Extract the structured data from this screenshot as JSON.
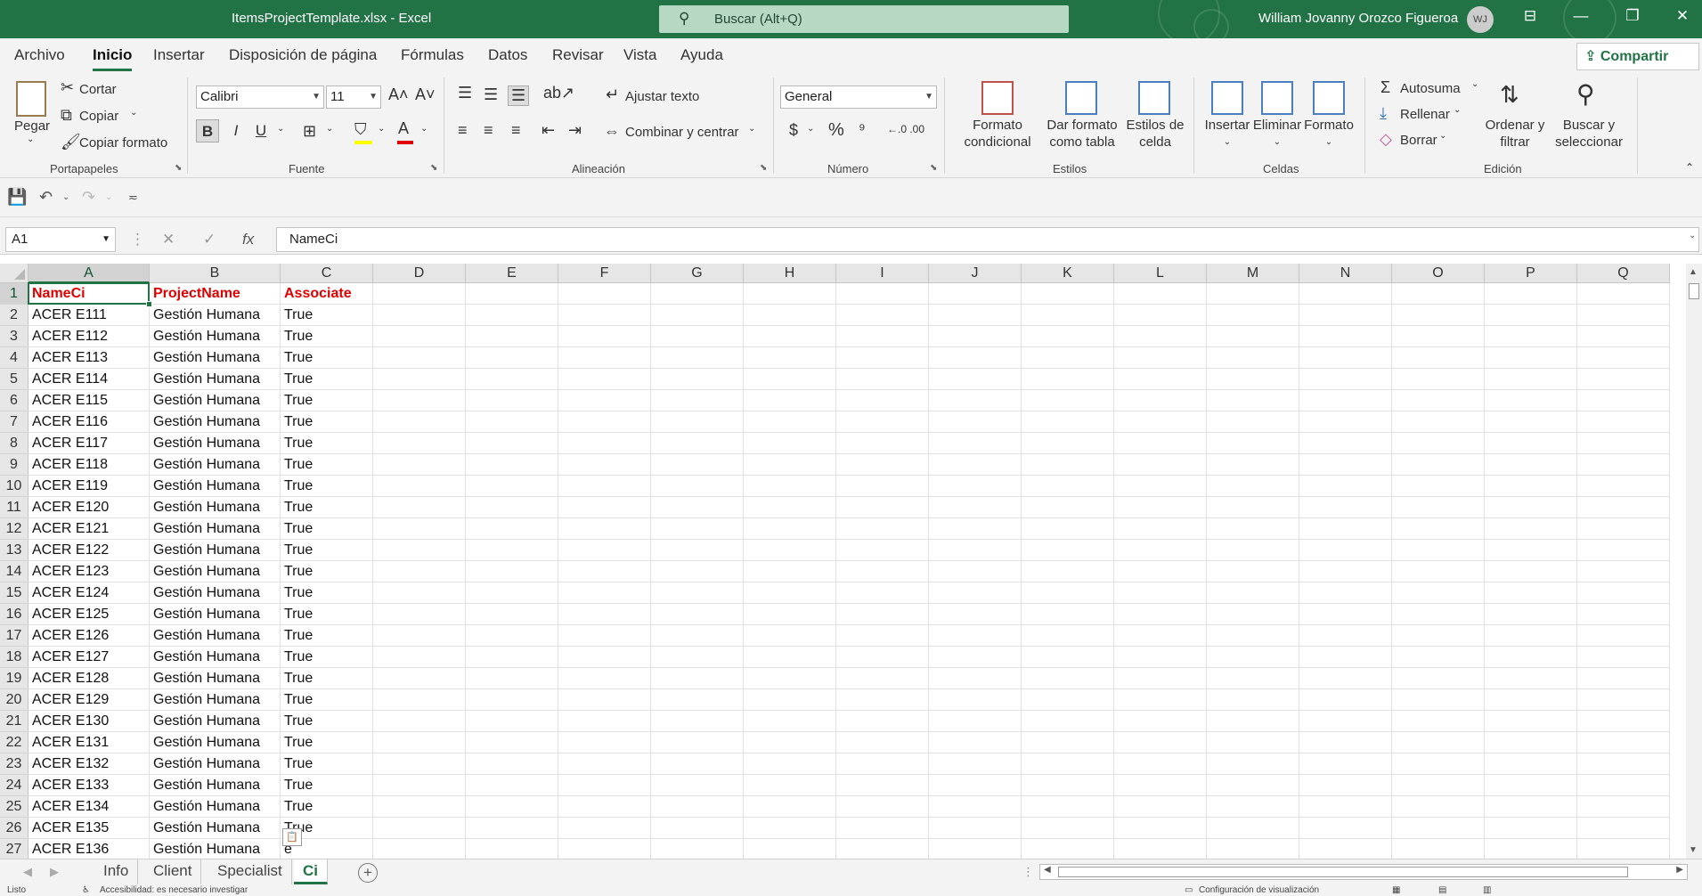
{
  "titlebar": {
    "doc_title": "ItemsProjectTemplate.xlsx  -  Excel",
    "search_placeholder": "Buscar (Alt+Q)",
    "user_name": "William Jovanny Orozco Figueroa",
    "avatar_initials": "WJ"
  },
  "menu": {
    "tabs": [
      "Archivo",
      "Inicio",
      "Insertar",
      "Disposición de página",
      "Fórmulas",
      "Datos",
      "Revisar",
      "Vista",
      "Ayuda"
    ],
    "active_tab": "Inicio",
    "share_label": "Compartir"
  },
  "ribbon": {
    "portapapeles": {
      "group_label": "Portapapeles",
      "paste": "Pegar",
      "cut": "Cortar",
      "copy": "Copiar",
      "format_painter": "Copiar formato"
    },
    "fuente": {
      "group_label": "Fuente",
      "font_name": "Calibri",
      "font_size": "11",
      "bold": "B",
      "italic": "I",
      "underline": "U"
    },
    "alineacion": {
      "group_label": "Alineación",
      "wrap_text": "Ajustar texto",
      "merge_center": "Combinar y centrar"
    },
    "numero": {
      "group_label": "Número",
      "format": "General"
    },
    "estilos": {
      "group_label": "Estilos",
      "conditional_l1": "Formato",
      "conditional_l2": "condicional",
      "table_l1": "Dar formato",
      "table_l2": "como tabla",
      "cell_styles_l1": "Estilos de",
      "cell_styles_l2": "celda"
    },
    "celdas": {
      "group_label": "Celdas",
      "insert": "Insertar",
      "delete": "Eliminar",
      "format": "Formato"
    },
    "edicion": {
      "group_label": "Edición",
      "autosum": "Autosuma",
      "fill": "Rellenar",
      "clear": "Borrar",
      "sort_l1": "Ordenar y",
      "sort_l2": "filtrar",
      "find_l1": "Buscar y",
      "find_l2": "seleccionar"
    }
  },
  "formula_bar": {
    "name_box": "A1",
    "formula": "NameCi"
  },
  "sheet": {
    "columns": [
      "A",
      "B",
      "C",
      "D",
      "E",
      "F",
      "G",
      "H",
      "I",
      "J",
      "K",
      "L",
      "M",
      "N",
      "O",
      "P",
      "Q"
    ],
    "rows": [
      [
        "1",
        "NameCi",
        "ProjectName",
        "Associate"
      ],
      [
        "2",
        "ACER E111",
        "Gestión Humana",
        "True"
      ],
      [
        "3",
        "ACER E112",
        "Gestión Humana",
        "True"
      ],
      [
        "4",
        "ACER E113",
        "Gestión Humana",
        "True"
      ],
      [
        "5",
        "ACER E114",
        "Gestión Humana",
        "True"
      ],
      [
        "6",
        "ACER E115",
        "Gestión Humana",
        "True"
      ],
      [
        "7",
        "ACER E116",
        "Gestión Humana",
        "True"
      ],
      [
        "8",
        "ACER E117",
        "Gestión Humana",
        "True"
      ],
      [
        "9",
        "ACER E118",
        "Gestión Humana",
        "True"
      ],
      [
        "10",
        "ACER E119",
        "Gestión Humana",
        "True"
      ],
      [
        "11",
        "ACER E120",
        "Gestión Humana",
        "True"
      ],
      [
        "12",
        "ACER E121",
        "Gestión Humana",
        "True"
      ],
      [
        "13",
        "ACER E122",
        "Gestión Humana",
        "True"
      ],
      [
        "14",
        "ACER E123",
        "Gestión Humana",
        "True"
      ],
      [
        "15",
        "ACER E124",
        "Gestión Humana",
        "True"
      ],
      [
        "16",
        "ACER E125",
        "Gestión Humana",
        "True"
      ],
      [
        "17",
        "ACER E126",
        "Gestión Humana",
        "True"
      ],
      [
        "18",
        "ACER E127",
        "Gestión Humana",
        "True"
      ],
      [
        "19",
        "ACER E128",
        "Gestión Humana",
        "True"
      ],
      [
        "20",
        "ACER E129",
        "Gestión Humana",
        "True"
      ],
      [
        "21",
        "ACER E130",
        "Gestión Humana",
        "True"
      ],
      [
        "22",
        "ACER E131",
        "Gestión Humana",
        "True"
      ],
      [
        "23",
        "ACER E132",
        "Gestión Humana",
        "True"
      ],
      [
        "24",
        "ACER E133",
        "Gestión Humana",
        "True"
      ],
      [
        "25",
        "ACER E134",
        "Gestión Humana",
        "True"
      ],
      [
        "26",
        "ACER E135",
        "Gestión Humana",
        "True"
      ],
      [
        "27",
        "ACER E136",
        "Gestión Humana",
        "e"
      ]
    ],
    "header_color": "#e00000",
    "selected_cell": "A1"
  },
  "sheet_tabs": {
    "tabs": [
      "Info",
      "Client",
      "Specialist",
      "Ci"
    ],
    "active": "Ci"
  },
  "status": {
    "ready": "Listo",
    "accessibility": "Accesibilidad: es necesario investigar",
    "display_settings": "Configuración de visualización"
  },
  "colors": {
    "accent": "#217346"
  }
}
